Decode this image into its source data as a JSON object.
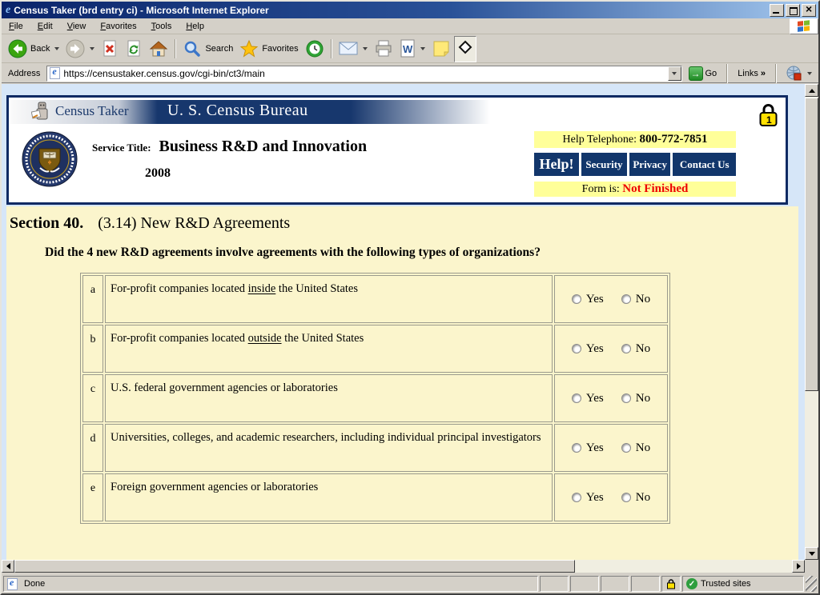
{
  "window": {
    "title": "Census Taker (brd entry ci) - Microsoft Internet Explorer",
    "menu": [
      "File",
      "Edit",
      "View",
      "Favorites",
      "Tools",
      "Help"
    ],
    "toolbar": {
      "back": "Back",
      "search": "Search",
      "favorites": "Favorites"
    },
    "address": {
      "label": "Address",
      "url": "https://censustaker.census.gov/cgi-bin/ct3/main",
      "go": "Go",
      "links": "Links",
      "links_chevron": "»"
    },
    "status": {
      "done": "Done",
      "zone": "Trusted sites"
    }
  },
  "page": {
    "banner": {
      "app": "Census Taker",
      "org": "U. S. Census Bureau"
    },
    "service": {
      "label": "Service Title:",
      "title": "Business R&D and Innovation",
      "year": "2008"
    },
    "helpbox": {
      "phone_label": "Help Telephone:",
      "phone": "800-772-7851",
      "buttons": [
        "Help!",
        "Security",
        "Privacy",
        "Contact Us"
      ],
      "form_label": "Form is:",
      "form_status": "Not Finished"
    },
    "section": {
      "number": "Section 40.",
      "title": "(3.14) New R&D Agreements"
    },
    "question": "Did the 4 new R&D agreements involve agreements with the following types of organizations?",
    "answers": {
      "yes": "Yes",
      "no": "No"
    },
    "rows": [
      {
        "letter": "a",
        "before": "For-profit companies located ",
        "underline": "inside",
        "after": " the United States"
      },
      {
        "letter": "b",
        "before": "For-profit companies located ",
        "underline": "outside",
        "after": " the United States"
      },
      {
        "letter": "c",
        "before": "U.S. federal government agencies or laboratories",
        "underline": "",
        "after": ""
      },
      {
        "letter": "d",
        "before": "Universities, colleges, and academic researchers, including individual principal investigators",
        "underline": "",
        "after": ""
      },
      {
        "letter": "e",
        "before": "Foreign government agencies or laboratories",
        "underline": "",
        "after": ""
      }
    ]
  },
  "colors": {
    "navy_button": "#12366B",
    "header_border": "#0E2A63",
    "bar_yellow": "#FFFF99",
    "page_yellow": "#FBF5CC",
    "status_red": "#EE0000",
    "titlebar_start": "#0A246A",
    "titlebar_end": "#A6CAF0"
  }
}
